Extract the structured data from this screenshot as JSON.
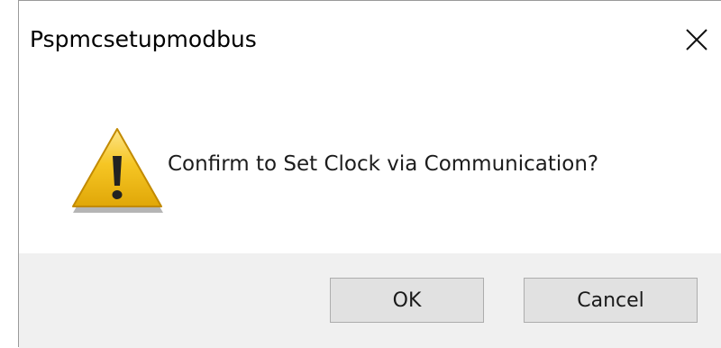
{
  "window": {
    "title": "Pspmcsetupmodbus",
    "close_icon": "close-icon"
  },
  "message": {
    "text": "Confirm to Set Clock via Communication?",
    "icon": "warning-icon"
  },
  "buttons": {
    "ok_label": "OK",
    "cancel_label": "Cancel"
  },
  "colors": {
    "warning_fill": "#f6c624",
    "footer_bg": "#f0f0f0",
    "button_bg": "#e1e1e1",
    "button_border": "#adadad"
  }
}
